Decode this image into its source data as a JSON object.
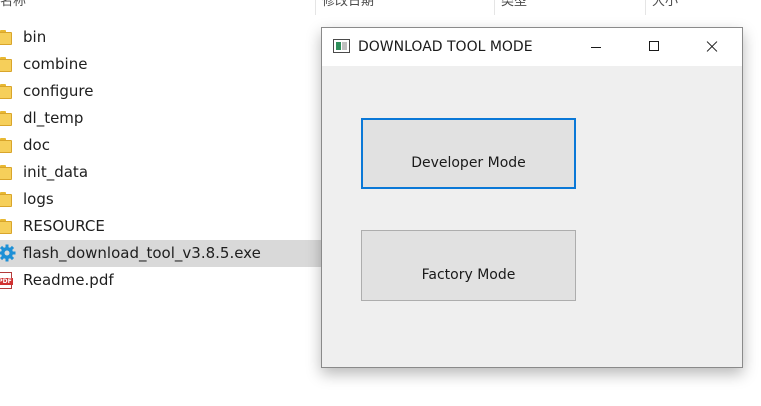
{
  "explorer": {
    "columns": [
      "名称",
      "修改日期",
      "类型",
      "大小"
    ],
    "files": [
      {
        "name": "bin",
        "icon": "folder-icon"
      },
      {
        "name": "combine",
        "icon": "folder-icon"
      },
      {
        "name": "configure",
        "icon": "folder-icon"
      },
      {
        "name": "dl_temp",
        "icon": "folder-icon"
      },
      {
        "name": "doc",
        "icon": "folder-icon"
      },
      {
        "name": "init_data",
        "icon": "folder-icon"
      },
      {
        "name": "logs",
        "icon": "folder-icon"
      },
      {
        "name": "RESOURCE",
        "icon": "folder-icon"
      },
      {
        "name": "flash_download_tool_v3.8.5.exe",
        "icon": "gear-icon",
        "selected": true
      },
      {
        "name": "Readme.pdf",
        "icon": "pdf-icon"
      }
    ]
  },
  "dialog": {
    "title": "DOWNLOAD TOOL MODE",
    "buttons": {
      "developer": "Developer Mode",
      "factory": "Factory Mode"
    }
  },
  "colors": {
    "selection": "#d9d9d9",
    "focus_border": "#0a78d7",
    "dialog_bg": "#efefef",
    "folder": "#f6cf5a",
    "gear": "#1e90d6"
  }
}
